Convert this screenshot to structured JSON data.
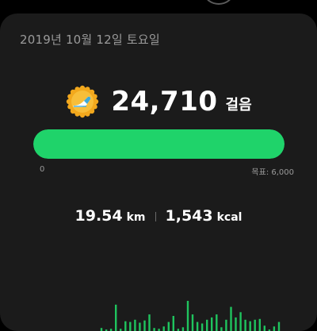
{
  "date": "2019년 10월 12일 토요일",
  "steps": {
    "value": "24,710",
    "unit": "걸음",
    "progress_fraction": 1.0,
    "scale_min": "0",
    "goal_label": "목표: 6,000"
  },
  "stats": {
    "distance_value": "19.54",
    "distance_unit": "km",
    "calories_value": "1,543",
    "calories_unit": "kcal"
  },
  "colors": {
    "background": "#000000",
    "card": "#1b1b1b",
    "accent_green": "#1fd36a",
    "chart_green": "#1fc45e",
    "muted_text": "#9a9a9a",
    "badge_gold": "#f2a81d",
    "badge_shoe": "#3fa8d8"
  },
  "icons": {
    "achievement_badge": "running-shoe-gold-badge-icon"
  },
  "chart_data": {
    "type": "bar",
    "title": "",
    "xlabel": "",
    "ylabel": "",
    "ylim": [
      0,
      100
    ],
    "values": [
      4,
      2,
      3,
      35,
      3,
      13,
      12,
      15,
      11,
      14,
      22,
      4,
      3,
      6,
      12,
      20,
      3,
      5,
      40,
      22,
      12,
      10,
      15,
      18,
      22,
      5,
      15,
      32,
      18,
      25,
      15,
      13,
      15,
      16,
      7,
      2,
      6,
      12
    ]
  }
}
